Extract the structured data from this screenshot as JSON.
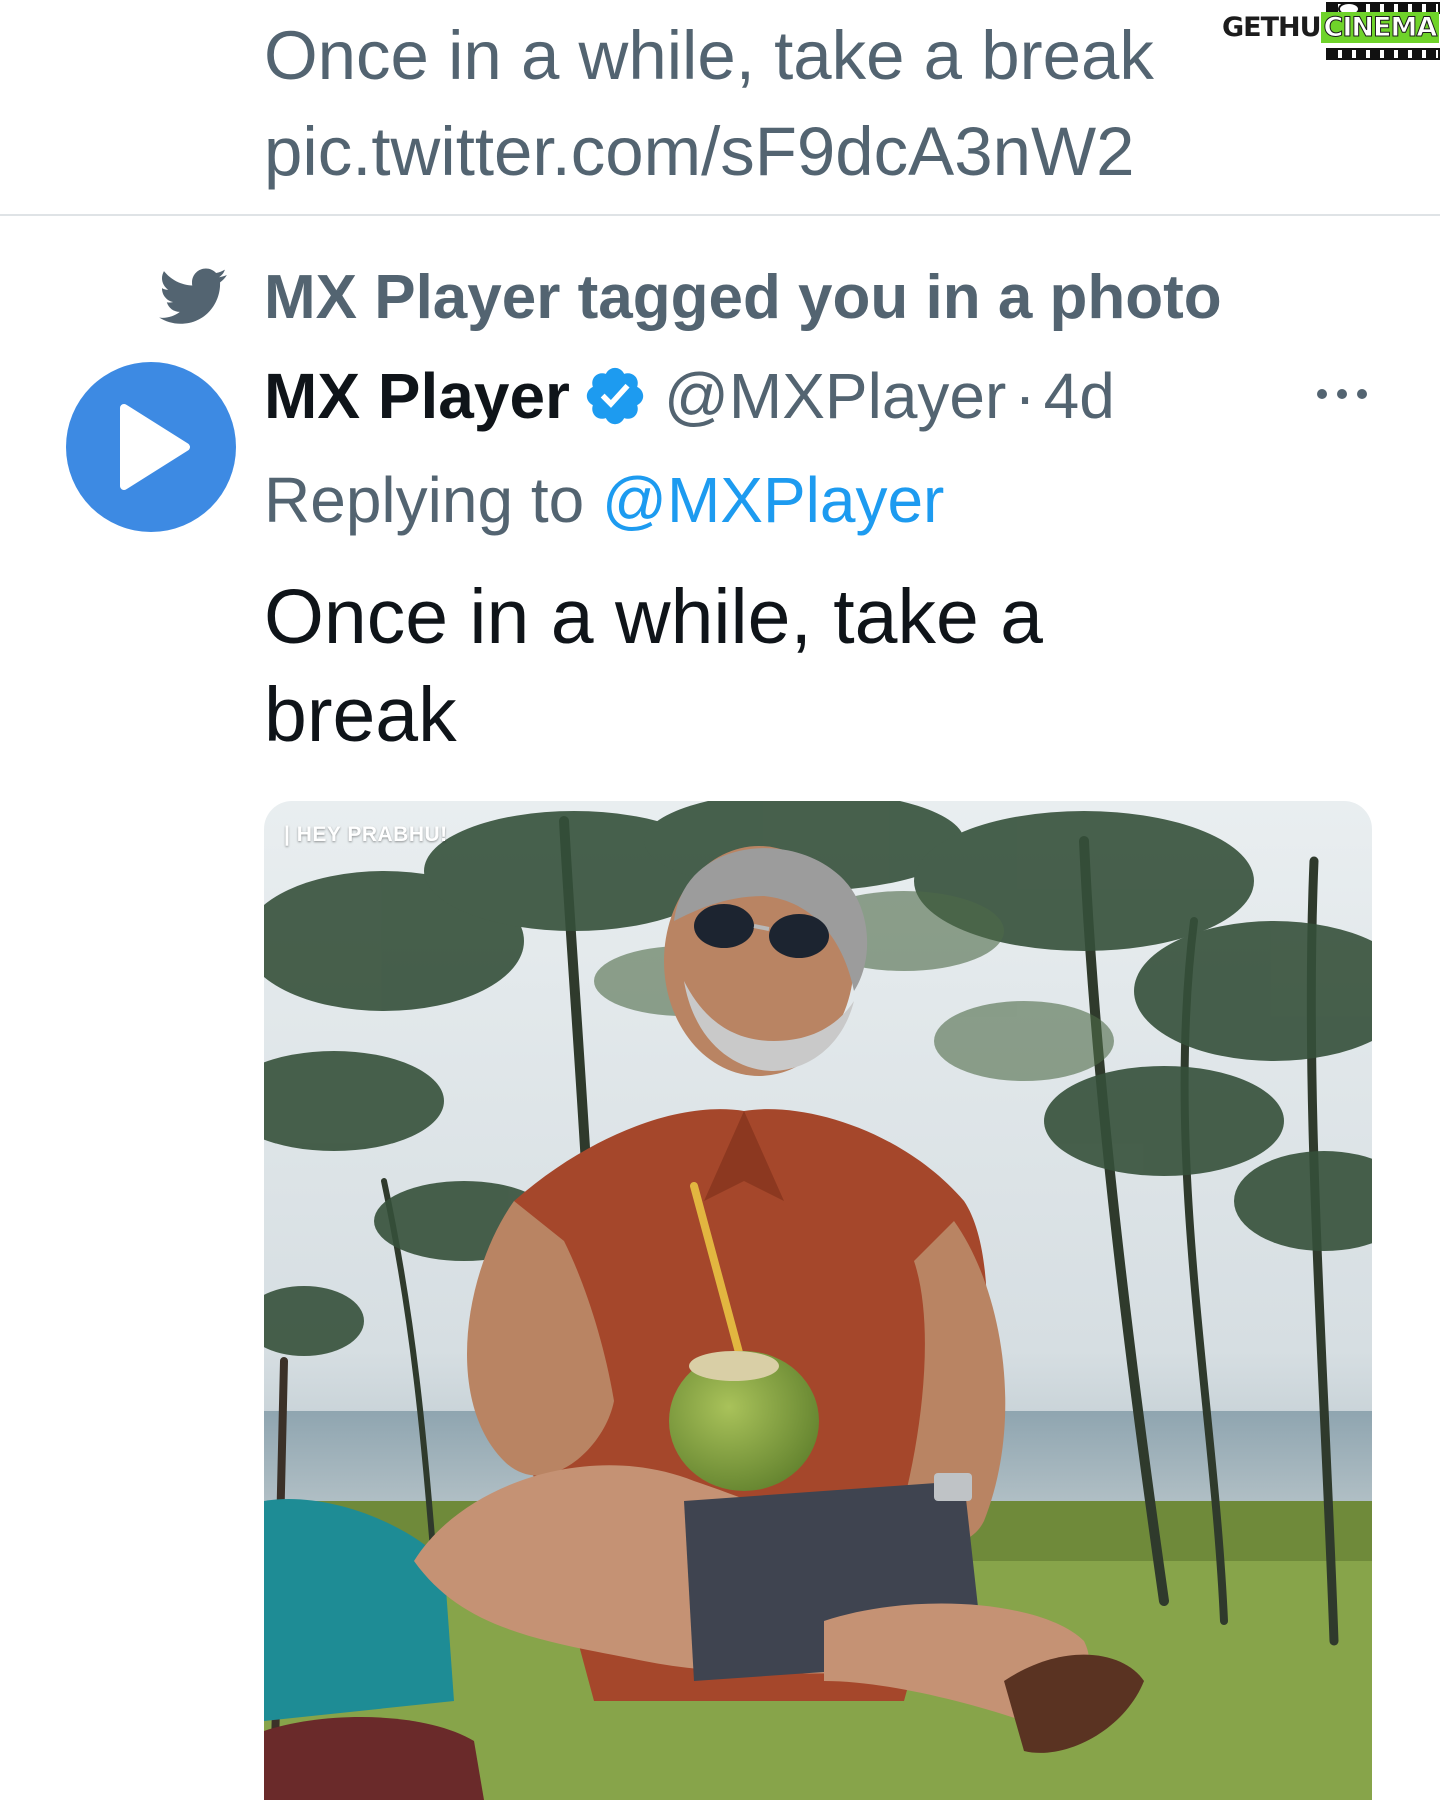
{
  "previous_tweet": {
    "text_line_1": "Once in a while, take a break",
    "text_line_2": "pic.twitter.com/sF9dcA3nW2"
  },
  "watermark": {
    "part_1": "GETHU",
    "part_2": "CINEMA"
  },
  "notification": {
    "icon": "twitter-bird-icon",
    "text": "MX Player tagged you in a photo"
  },
  "tweet": {
    "avatar_icon": "play-icon",
    "author_name": "MX Player",
    "verified_icon": "verified-badge-icon",
    "handle": "@MXPlayer",
    "separator": "·",
    "time": "4d",
    "more_icon": "more-options-icon",
    "replying_prefix": "Replying to ",
    "replying_handle": "@MXPlayer",
    "text_line_1": "Once in a while, take a",
    "text_line_2": "break",
    "photo_label": "| HEY PRABHU!"
  },
  "colors": {
    "secondary_text": "#536471",
    "primary_text": "#0f1419",
    "link": "#1d9bf0",
    "avatar_bg": "#3d8ae3"
  }
}
